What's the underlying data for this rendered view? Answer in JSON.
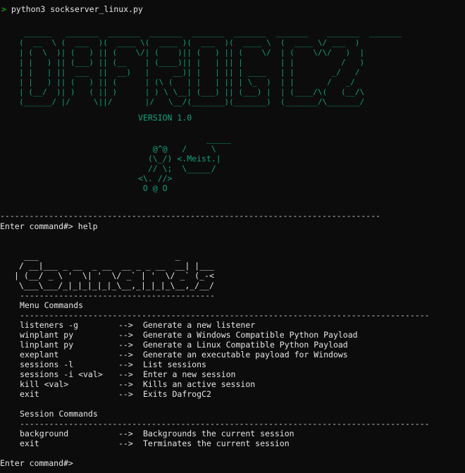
{
  "terminal": {
    "first_prompt_arrow": ">",
    "first_command": "python3 sockserver_linux.py",
    "banner_lines": [
      " ______   _______  _______  _______  _______  _______  _______    _______  _______ ",
      "(  __  \\ (  ___  )(  ____ \\(  ____ )(  ___  )(  ____ \\  (  ____ \\/ ___  )",
      "| (  \\  )| (   ) || (    \\/| (    )|| (   ) || (    \\/  | (    \\/\\/   )  |",
      "| |   ) || (___) || (__    | (____)|| |   | || |        | |          /   )",
      "| |   | ||  ___  ||  __)   |     __)| |   | || | ____   | |        _/   / ",
      "| |   ) || (   ) || (      | (\\ (   | |   | || | \\_  )  | |       /   _/  ",
      "| (__/  )| )   ( || )      | ) \\ \\__| (___) || (___) |  | (____/\\(   (__/\\",
      "(______/ |/     \\||/       |/   \\__/(_______)(_______)  (_______/\\_______/"
    ],
    "version": "VERSION 1.0",
    "frog_lines": [
      "              _____",
      "   @^@   /     \\",
      "  (\\_/) <.Meist.|",
      "  // \\;  \\_____/",
      "<\\. //>",
      " O @ O"
    ],
    "separator_top": "------------------------------------------------------------------------------",
    "second_prompt": "Enter command#>",
    "second_command": "help",
    "help_logo_lines": [
      "  ___                            _",
      " / __|___ _ __  _ __  __ _ _ __  __| |___",
      "| (__/ _ \\ '  \\| '  \\/ _` | '  \\/ _` (_-<",
      " \\___\\___/_|_|_|_|_|_\\__,_|_|_|_\\__,_/__/"
    ],
    "help_logo_underline": "----------------------------------------",
    "menu_header": "Menu Commands",
    "menu_separator": "------------------------------------------------------------------------------------",
    "menu_commands": [
      {
        "cmd": "listeners -g",
        "arrow": "-->",
        "desc": "Generate a new listener"
      },
      {
        "cmd": "winplant py",
        "arrow": "-->",
        "desc": "Generate a Windows Compatible Python Payload"
      },
      {
        "cmd": "linplant py",
        "arrow": "-->",
        "desc": "Generate a Linux Compatible Python Payload"
      },
      {
        "cmd": "exeplant",
        "arrow": "-->",
        "desc": "Generate an executable payload for Windows"
      },
      {
        "cmd": "sessions -l",
        "arrow": "-->",
        "desc": "List sessions"
      },
      {
        "cmd": "sessions -i <val>",
        "arrow": "-->",
        "desc": "Enter a new session"
      },
      {
        "cmd": "kill <val>",
        "arrow": "-->",
        "desc": "Kills an active session"
      },
      {
        "cmd": "exit",
        "arrow": "-->",
        "desc": "Exits DafrogC2"
      }
    ],
    "session_header": "Session Commands",
    "session_separator": "------------------------------------------------------------------------------------",
    "session_commands": [
      {
        "cmd": "background",
        "arrow": "-->",
        "desc": "Backgrounds the current session"
      },
      {
        "cmd": "exit",
        "arrow": "-->",
        "desc": "Terminates the current session"
      }
    ],
    "third_prompt": "Enter command#>",
    "colors": {
      "background": "#0c0c0c",
      "text": "#cccccc",
      "banner": "#12a079",
      "prompt_arrow": "#16c60c"
    }
  }
}
